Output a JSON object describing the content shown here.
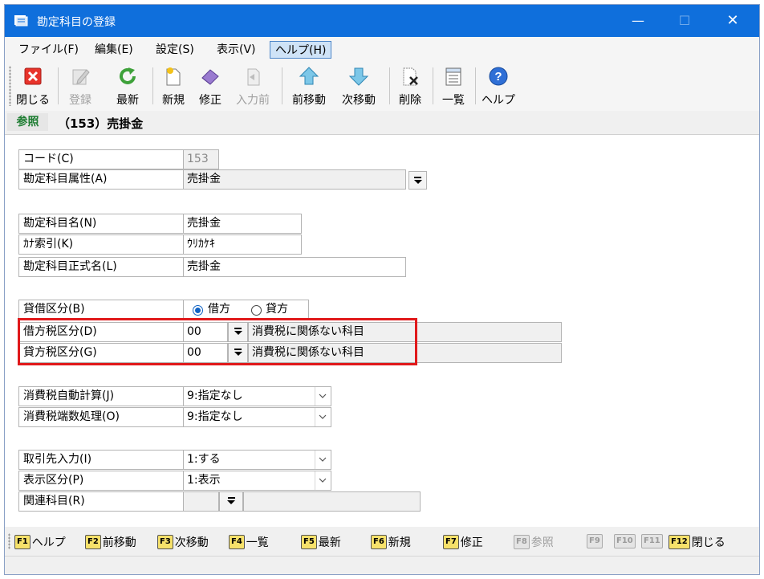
{
  "window": {
    "title": "勘定科目の登録",
    "controls": {
      "minimize": "—",
      "maximize": "☐",
      "close": "✕"
    }
  },
  "menu": [
    "ファイル(F)",
    "編集(E)",
    "設定(S)",
    "表示(V)",
    "ヘルプ(H)"
  ],
  "toolbar": [
    {
      "label": "閉じる",
      "icon": "close-x-icon",
      "enabled": true
    },
    {
      "label": "登録",
      "icon": "register-pencil-icon",
      "enabled": false
    },
    {
      "label": "最新",
      "icon": "refresh-icon",
      "enabled": true
    },
    {
      "label": "新規",
      "icon": "new-doc-icon",
      "enabled": true
    },
    {
      "label": "修正",
      "icon": "eraser-icon",
      "enabled": true
    },
    {
      "label": "入力前",
      "icon": "undo-icon",
      "enabled": false
    },
    {
      "label": "前移動",
      "icon": "arrow-up-icon",
      "enabled": true
    },
    {
      "label": "次移動",
      "icon": "arrow-down-icon",
      "enabled": true
    },
    {
      "label": "削除",
      "icon": "delete-doc-icon",
      "enabled": true
    },
    {
      "label": "一覧",
      "icon": "list-icon",
      "enabled": true
    },
    {
      "label": "ヘルプ",
      "icon": "help-icon",
      "enabled": true
    }
  ],
  "mode": {
    "badge": "参照",
    "title": "（153）売掛金"
  },
  "form": {
    "code": {
      "label": "コード(C)",
      "value": "153"
    },
    "attribute": {
      "label": "勘定科目属性(A)",
      "value": "売掛金"
    },
    "name": {
      "label": "勘定科目名(N)",
      "value": "売掛金"
    },
    "kana": {
      "label": "ｶﾅ索引(K)",
      "value": "ｳﾘｶｹｷ"
    },
    "formal_name": {
      "label": "勘定科目正式名(L)",
      "value": "売掛金"
    },
    "debit_credit": {
      "label": "貸借区分(B)",
      "options": [
        "借方",
        "貸方"
      ],
      "selected": "借方"
    },
    "debit_tax": {
      "label": "借方税区分(D)",
      "code": "00",
      "desc": "消費税に関係ない科目"
    },
    "credit_tax": {
      "label": "貸方税区分(G)",
      "code": "00",
      "desc": "消費税に関係ない科目"
    },
    "auto_tax": {
      "label": "消費税自動計算(J)",
      "value": "9:指定なし"
    },
    "tax_rounding": {
      "label": "消費税端数処理(O)",
      "value": "9:指定なし"
    },
    "partner_input": {
      "label": "取引先入力(I)",
      "value": "1:する"
    },
    "display_class": {
      "label": "表示区分(P)",
      "value": "1:表示"
    },
    "related_account": {
      "label": "関連科目(R)",
      "value": ""
    }
  },
  "fkeys": [
    {
      "key": "F1",
      "label": "ヘルプ",
      "enabled": true
    },
    {
      "key": "F2",
      "label": "前移動",
      "enabled": true
    },
    {
      "key": "F3",
      "label": "次移動",
      "enabled": true
    },
    {
      "key": "F4",
      "label": "一覧",
      "enabled": true
    },
    {
      "key": "F5",
      "label": "最新",
      "enabled": true
    },
    {
      "key": "F6",
      "label": "新規",
      "enabled": true
    },
    {
      "key": "F7",
      "label": "修正",
      "enabled": true
    },
    {
      "key": "F8",
      "label": "参照",
      "enabled": false
    },
    {
      "key": "F9",
      "label": "",
      "enabled": false
    },
    {
      "key": "F10",
      "label": "",
      "enabled": false
    },
    {
      "key": "F11",
      "label": "",
      "enabled": false
    },
    {
      "key": "F12",
      "label": "閉じる",
      "enabled": true
    }
  ],
  "colors": {
    "titlebar": "#0f6fdc",
    "highlight": "#e0191b",
    "mode_badge": "#1e7d32",
    "fkey": "#f6e16a"
  }
}
